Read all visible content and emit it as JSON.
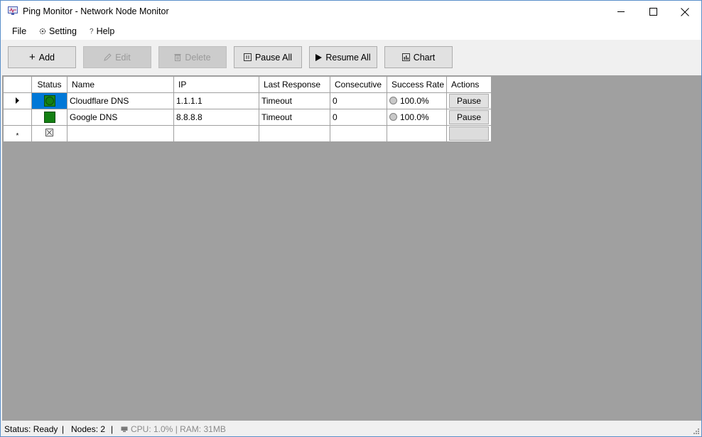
{
  "window": {
    "title": "Ping Monitor - Network Node Monitor",
    "app_icon": "monitor-icon"
  },
  "menu": [
    {
      "label": "File",
      "icon": ""
    },
    {
      "label": "Setting",
      "icon": "gear-icon"
    },
    {
      "label": "Help",
      "icon": "question-icon"
    }
  ],
  "toolbar": {
    "add": {
      "label": "Add",
      "icon": "plus-icon"
    },
    "edit": {
      "label": "Edit",
      "icon": "pencil-icon",
      "enabled": false
    },
    "delete": {
      "label": "Delete",
      "icon": "trash-icon",
      "enabled": false
    },
    "pause_all": {
      "label": "Pause All",
      "icon": "pause-icon"
    },
    "resume_all": {
      "label": "Resume All",
      "icon": "play-icon"
    },
    "chart": {
      "label": "Chart",
      "icon": "bar-chart-icon"
    }
  },
  "grid": {
    "columns": [
      "Status",
      "Name",
      "IP",
      "Last Response",
      "Consecutive",
      "Success Rate",
      "Actions"
    ],
    "rows": [
      {
        "name": "Cloudflare DNS",
        "ip": "1.1.1.1",
        "last_response": "Timeout",
        "consecutive": "0",
        "success_rate": "100.0%",
        "action": "Pause",
        "status_color": "#138013",
        "selected": true
      },
      {
        "name": "Google DNS",
        "ip": "8.8.8.8",
        "last_response": "Timeout",
        "consecutive": "0",
        "success_rate": "100.0%",
        "action": "Pause",
        "status_color": "#138013",
        "selected": false
      }
    ],
    "new_row_marker": "*"
  },
  "statusbar": {
    "status": "Status: Ready",
    "sep1": "|",
    "nodes": "Nodes: 2",
    "sep2": "|",
    "resources": "CPU: 1.0% | RAM: 31MB"
  },
  "colors": {
    "selection": "#0078d7",
    "grid_background": "#a0a0a0",
    "status_ok": "#138013"
  }
}
